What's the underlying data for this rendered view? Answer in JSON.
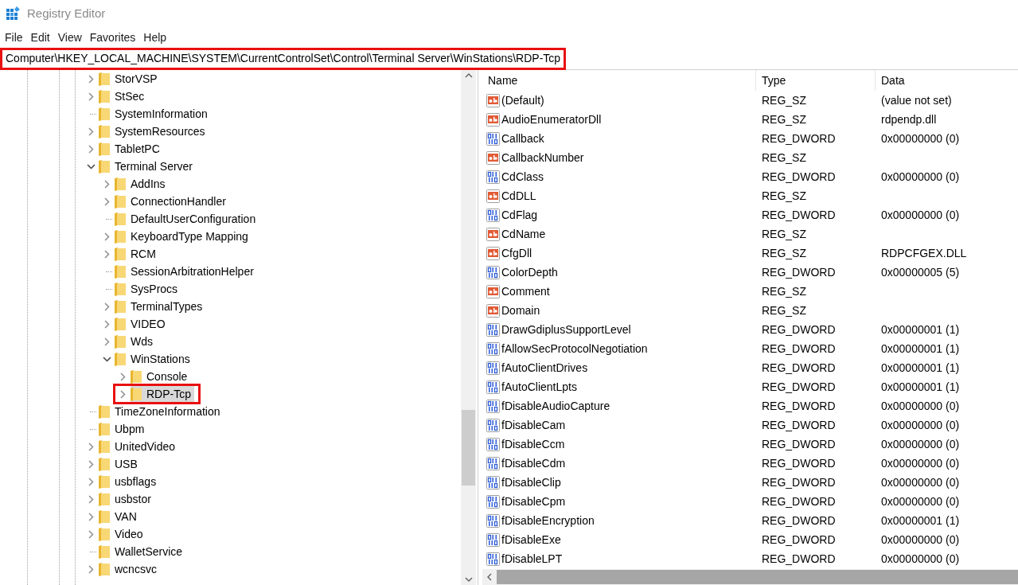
{
  "window": {
    "title": "Registry Editor"
  },
  "menu": [
    "File",
    "Edit",
    "View",
    "Favorites",
    "Help"
  ],
  "address_bar": {
    "path": "Computer\\HKEY_LOCAL_MACHINE\\SYSTEM\\CurrentControlSet\\Control\\Terminal Server\\WinStations\\RDP-Tcp",
    "highlighted": true
  },
  "tree": [
    {
      "label": "StorVSP",
      "expandable": true,
      "expanded": false,
      "selected": false,
      "highlighted": false
    },
    {
      "label": "StSec",
      "expandable": true,
      "expanded": false,
      "selected": false,
      "highlighted": false
    },
    {
      "label": "SystemInformation",
      "expandable": false,
      "selected": false,
      "highlighted": false
    },
    {
      "label": "SystemResources",
      "expandable": true,
      "expanded": false,
      "selected": false,
      "highlighted": false
    },
    {
      "label": "TabletPC",
      "expandable": true,
      "expanded": false,
      "selected": false,
      "highlighted": false
    },
    {
      "label": "Terminal Server",
      "expandable": true,
      "expanded": true,
      "selected": false,
      "highlighted": false,
      "children": [
        {
          "label": "AddIns",
          "expandable": true,
          "expanded": false,
          "selected": false,
          "highlighted": false
        },
        {
          "label": "ConnectionHandler",
          "expandable": true,
          "expanded": false,
          "selected": false,
          "highlighted": false
        },
        {
          "label": "DefaultUserConfiguration",
          "expandable": false,
          "selected": false,
          "highlighted": false
        },
        {
          "label": "KeyboardType Mapping",
          "expandable": true,
          "expanded": false,
          "selected": false,
          "highlighted": false
        },
        {
          "label": "RCM",
          "expandable": true,
          "expanded": false,
          "selected": false,
          "highlighted": false
        },
        {
          "label": "SessionArbitrationHelper",
          "expandable": false,
          "selected": false,
          "highlighted": false
        },
        {
          "label": "SysProcs",
          "expandable": false,
          "selected": false,
          "highlighted": false
        },
        {
          "label": "TerminalTypes",
          "expandable": true,
          "expanded": false,
          "selected": false,
          "highlighted": false
        },
        {
          "label": "VIDEO",
          "expandable": true,
          "expanded": false,
          "selected": false,
          "highlighted": false
        },
        {
          "label": "Wds",
          "expandable": true,
          "expanded": false,
          "selected": false,
          "highlighted": false
        },
        {
          "label": "WinStations",
          "expandable": true,
          "expanded": true,
          "selected": false,
          "highlighted": false,
          "children": [
            {
              "label": "Console",
              "expandable": true,
              "expanded": false,
              "selected": false,
              "highlighted": false
            },
            {
              "label": "RDP-Tcp",
              "expandable": true,
              "expanded": false,
              "selected": true,
              "highlighted": true
            }
          ]
        }
      ]
    },
    {
      "label": "TimeZoneInformation",
      "expandable": false,
      "selected": false,
      "highlighted": false
    },
    {
      "label": "Ubpm",
      "expandable": false,
      "selected": false,
      "highlighted": false
    },
    {
      "label": "UnitedVideo",
      "expandable": true,
      "expanded": false,
      "selected": false,
      "highlighted": false
    },
    {
      "label": "USB",
      "expandable": true,
      "expanded": false,
      "selected": false,
      "highlighted": false
    },
    {
      "label": "usbflags",
      "expandable": true,
      "expanded": false,
      "selected": false,
      "highlighted": false
    },
    {
      "label": "usbstor",
      "expandable": true,
      "expanded": false,
      "selected": false,
      "highlighted": false
    },
    {
      "label": "VAN",
      "expandable": true,
      "expanded": false,
      "selected": false,
      "highlighted": false
    },
    {
      "label": "Video",
      "expandable": true,
      "expanded": false,
      "selected": false,
      "highlighted": false
    },
    {
      "label": "WalletService",
      "expandable": false,
      "selected": false,
      "highlighted": false
    },
    {
      "label": "wcncsvc",
      "expandable": true,
      "expanded": false,
      "selected": false,
      "highlighted": false
    }
  ],
  "values": {
    "columns": [
      "Name",
      "Type",
      "Data"
    ],
    "rows": [
      {
        "kind": "string",
        "name": "(Default)",
        "type": "REG_SZ",
        "data": "(value not set)"
      },
      {
        "kind": "string",
        "name": "AudioEnumeratorDll",
        "type": "REG_SZ",
        "data": "rdpendp.dll"
      },
      {
        "kind": "dword",
        "name": "Callback",
        "type": "REG_DWORD",
        "data": "0x00000000 (0)"
      },
      {
        "kind": "string",
        "name": "CallbackNumber",
        "type": "REG_SZ"
      },
      {
        "kind": "dword",
        "name": "CdClass",
        "type": "REG_DWORD",
        "data": "0x00000000 (0)"
      },
      {
        "kind": "string",
        "name": "CdDLL",
        "type": "REG_SZ"
      },
      {
        "kind": "dword",
        "name": "CdFlag",
        "type": "REG_DWORD",
        "data": "0x00000000 (0)"
      },
      {
        "kind": "string",
        "name": "CdName",
        "type": "REG_SZ"
      },
      {
        "kind": "string",
        "name": "CfgDll",
        "type": "REG_SZ",
        "data": "RDPCFGEX.DLL"
      },
      {
        "kind": "dword",
        "name": "ColorDepth",
        "type": "REG_DWORD",
        "data": "0x00000005 (5)"
      },
      {
        "kind": "string",
        "name": "Comment",
        "type": "REG_SZ"
      },
      {
        "kind": "string",
        "name": "Domain",
        "type": "REG_SZ"
      },
      {
        "kind": "dword",
        "name": "DrawGdiplusSupportLevel",
        "type": "REG_DWORD",
        "data": "0x00000001 (1)"
      },
      {
        "kind": "dword",
        "name": "fAllowSecProtocolNegotiation",
        "type": "REG_DWORD",
        "data": "0x00000001 (1)"
      },
      {
        "kind": "dword",
        "name": "fAutoClientDrives",
        "type": "REG_DWORD",
        "data": "0x00000001 (1)"
      },
      {
        "kind": "dword",
        "name": "fAutoClientLpts",
        "type": "REG_DWORD",
        "data": "0x00000001 (1)"
      },
      {
        "kind": "dword",
        "name": "fDisableAudioCapture",
        "type": "REG_DWORD",
        "data": "0x00000000 (0)"
      },
      {
        "kind": "dword",
        "name": "fDisableCam",
        "type": "REG_DWORD",
        "data": "0x00000000 (0)"
      },
      {
        "kind": "dword",
        "name": "fDisableCcm",
        "type": "REG_DWORD",
        "data": "0x00000000 (0)"
      },
      {
        "kind": "dword",
        "name": "fDisableCdm",
        "type": "REG_DWORD",
        "data": "0x00000000 (0)"
      },
      {
        "kind": "dword",
        "name": "fDisableClip",
        "type": "REG_DWORD",
        "data": "0x00000000 (0)"
      },
      {
        "kind": "dword",
        "name": "fDisableCpm",
        "type": "REG_DWORD",
        "data": "0x00000000 (0)"
      },
      {
        "kind": "dword",
        "name": "fDisableEncryption",
        "type": "REG_DWORD",
        "data": "0x00000001 (1)"
      },
      {
        "kind": "dword",
        "name": "fDisableExe",
        "type": "REG_DWORD",
        "data": "0x00000000 (0)"
      },
      {
        "kind": "dword",
        "name": "fDisableLPT",
        "type": "REG_DWORD",
        "data": "0x00000000 (0)"
      }
    ]
  }
}
